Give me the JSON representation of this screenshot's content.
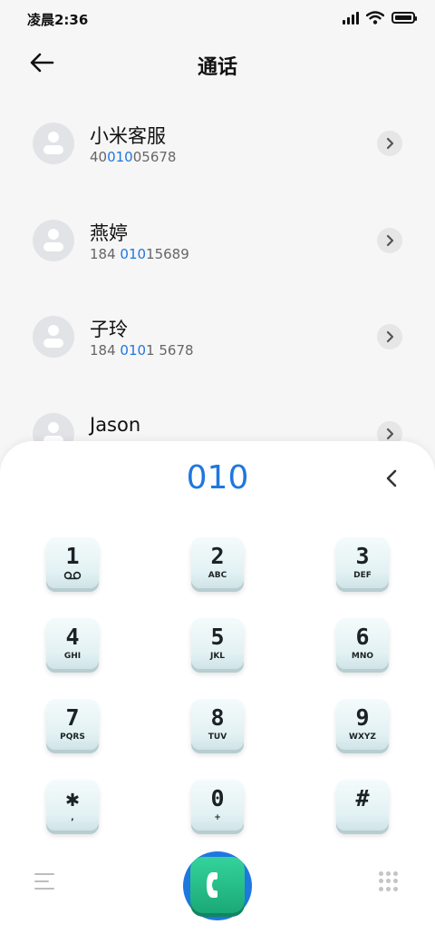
{
  "status_bar": {
    "time": "凌晨2:36",
    "icons": [
      "signal-icon",
      "wifi-icon",
      "battery-icon"
    ]
  },
  "header": {
    "title": "通话",
    "back_icon": "back-arrow-icon"
  },
  "contacts": [
    {
      "name": "小米客服",
      "number_pre": "40",
      "number_hl": "010",
      "number_post": "05678"
    },
    {
      "name": "燕婷",
      "number_pre": "184 ",
      "number_hl": "010",
      "number_post": "15689"
    },
    {
      "name": "子玲",
      "number_pre": "184 ",
      "number_hl": "010",
      "number_post": "1 5678"
    },
    {
      "name": "Jason",
      "number_pre": "",
      "number_hl": "",
      "number_post": ""
    }
  ],
  "dialpad": {
    "dialed": "010",
    "keys": [
      {
        "digit": "1",
        "letters": ""
      },
      {
        "digit": "2",
        "letters": "ABC"
      },
      {
        "digit": "3",
        "letters": "DEF"
      },
      {
        "digit": "4",
        "letters": "GHI"
      },
      {
        "digit": "5",
        "letters": "JKL"
      },
      {
        "digit": "6",
        "letters": "MNO"
      },
      {
        "digit": "7",
        "letters": "PQRS"
      },
      {
        "digit": "8",
        "letters": "TUV"
      },
      {
        "digit": "9",
        "letters": "WXYZ"
      },
      {
        "digit": "✱",
        "letters": ","
      },
      {
        "digit": "0",
        "letters": "+"
      },
      {
        "digit": "#",
        "letters": ""
      }
    ]
  },
  "colors": {
    "accent": "#1f77e0",
    "call_green": "#22bf88"
  }
}
